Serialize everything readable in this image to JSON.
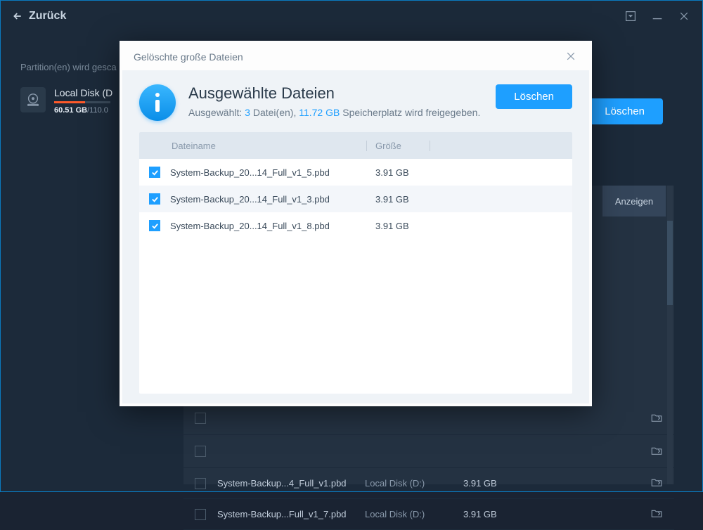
{
  "titlebar": {
    "back_label": "Zurück"
  },
  "background": {
    "scan_label": "Partition(en) wird gesca",
    "disk_name": "Local Disk (D",
    "disk_used": "60.51 GB",
    "disk_total": "/110.0",
    "delete_btn": "Löschen",
    "anzeigen": "Anzeigen",
    "rows": [
      {
        "name": "System-Backup...4_Full_v1.pbd",
        "loc": "Local Disk (D:)",
        "size": "3.91 GB"
      },
      {
        "name": "System-Backup...Full_v1_7.pbd",
        "loc": "Local Disk (D:)",
        "size": "3.91 GB"
      }
    ]
  },
  "modal": {
    "title": "Gelöschte große Dateien",
    "heading": "Ausgewählte Dateien",
    "sub_prefix": "Ausgewählt: ",
    "sub_count": "3",
    "sub_mid": " Datei(en), ",
    "sub_size": "11.72 GB",
    "sub_suffix": " Speicherplatz wird freigegeben.",
    "delete_btn": "Löschen",
    "col_name": "Dateiname",
    "col_size": "Größe",
    "files": [
      {
        "name": "System-Backup_20...14_Full_v1_5.pbd",
        "size": "3.91 GB"
      },
      {
        "name": "System-Backup_20...14_Full_v1_3.pbd",
        "size": "3.91 GB"
      },
      {
        "name": "System-Backup_20...14_Full_v1_8.pbd",
        "size": "3.91 GB"
      }
    ]
  }
}
